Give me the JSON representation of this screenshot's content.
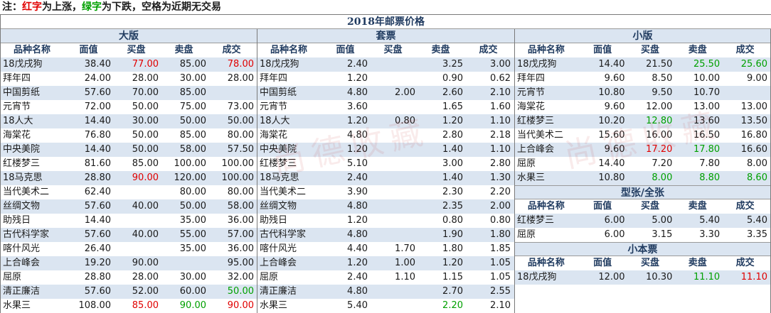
{
  "note": {
    "prefix": "注：",
    "red": "红字",
    "mid1": "为上涨，",
    "green": "绿字",
    "mid2": "为下跌，空格为近期无交易"
  },
  "title": "2018年邮票价格",
  "columns": [
    "品种名称",
    "面值",
    "买盘",
    "卖盘",
    "成交"
  ],
  "sections": {
    "daban": {
      "title": "大版",
      "rows": [
        {
          "name": "18戊戌狗",
          "face": "38.40",
          "buy": "77.00",
          "sell": "85.00",
          "deal": "78.00",
          "buy_color": "red",
          "sell_color": "",
          "deal_color": "red"
        },
        {
          "name": "拜年四",
          "face": "24.00",
          "buy": "28.00",
          "sell": "30.00",
          "deal": "28.00"
        },
        {
          "name": "中国剪纸",
          "face": "57.60",
          "buy": "70.00",
          "sell": "85.00",
          "deal": ""
        },
        {
          "name": "元宵节",
          "face": "72.00",
          "buy": "50.00",
          "sell": "75.00",
          "deal": "73.00"
        },
        {
          "name": "18人大",
          "face": "14.40",
          "buy": "30.00",
          "sell": "50.00",
          "deal": "50.00"
        },
        {
          "name": "海棠花",
          "face": "76.80",
          "buy": "50.00",
          "sell": "85.00",
          "deal": "80.00"
        },
        {
          "name": "中央美院",
          "face": "14.40",
          "buy": "50.00",
          "sell": "58.00",
          "deal": "57.50"
        },
        {
          "name": "红楼梦三",
          "face": "81.60",
          "buy": "85.00",
          "sell": "100.00",
          "deal": "100.00"
        },
        {
          "name": "18马克思",
          "face": "28.80",
          "buy": "90.00",
          "sell": "120.00",
          "deal": "100.00",
          "buy_color": "red"
        },
        {
          "name": "当代美术二",
          "face": "62.40",
          "buy": "",
          "sell": "80.00",
          "deal": "80.00"
        },
        {
          "name": "丝绸文物",
          "face": "57.60",
          "buy": "40.00",
          "sell": "50.00",
          "deal": "58.00"
        },
        {
          "name": "助残日",
          "face": "14.40",
          "buy": "",
          "sell": "35.00",
          "deal": "36.00"
        },
        {
          "name": "古代科学家",
          "face": "57.60",
          "buy": "40.00",
          "sell": "55.00",
          "deal": "57.00"
        },
        {
          "name": "喀什风光",
          "face": "26.40",
          "buy": "",
          "sell": "35.00",
          "deal": "36.00"
        },
        {
          "name": "上合峰会",
          "face": "19.20",
          "buy": "90.00",
          "sell": "",
          "deal": "95.00"
        },
        {
          "name": "屈原",
          "face": "28.80",
          "buy": "28.00",
          "sell": "30.00",
          "deal": "32.00"
        },
        {
          "name": "清正廉洁",
          "face": "57.60",
          "buy": "52.00",
          "sell": "60.00",
          "deal": "50.00",
          "deal_color": "green"
        },
        {
          "name": "水果三",
          "face": "108.00",
          "buy": "85.00",
          "sell": "90.00",
          "deal": "90.00",
          "buy_color": "red",
          "sell_color": "green",
          "deal_color": "red"
        }
      ]
    },
    "taopiao": {
      "title": "套票",
      "rows": [
        {
          "name": "18戊戌狗",
          "face": "2.40",
          "buy": "",
          "sell": "3.25",
          "deal": "3.00"
        },
        {
          "name": "拜年四",
          "face": "1.20",
          "buy": "",
          "sell": "0.90",
          "deal": "0.62"
        },
        {
          "name": "中国剪纸",
          "face": "4.80",
          "buy": "2.00",
          "sell": "2.60",
          "deal": "2.10"
        },
        {
          "name": "元宵节",
          "face": "3.60",
          "buy": "",
          "sell": "1.65",
          "deal": "1.60"
        },
        {
          "name": "18人大",
          "face": "1.20",
          "buy": "0.80",
          "sell": "1.20",
          "deal": "1.10"
        },
        {
          "name": "海棠花",
          "face": "4.80",
          "buy": "",
          "sell": "2.80",
          "deal": "2.18"
        },
        {
          "name": "中央美院",
          "face": "1.20",
          "buy": "",
          "sell": "1.40",
          "deal": "1.10"
        },
        {
          "name": "红楼梦三",
          "face": "5.10",
          "buy": "",
          "sell": "3.00",
          "deal": "2.80"
        },
        {
          "name": "18马克思",
          "face": "2.40",
          "buy": "",
          "sell": "1.40",
          "deal": "1.30"
        },
        {
          "name": "当代美术二",
          "face": "3.90",
          "buy": "",
          "sell": "2.30",
          "deal": "2.20"
        },
        {
          "name": "丝绸文物",
          "face": "4.80",
          "buy": "",
          "sell": "2.35",
          "deal": "2.00"
        },
        {
          "name": "助残日",
          "face": "1.20",
          "buy": "",
          "sell": "0.80",
          "deal": "0.80"
        },
        {
          "name": "古代科学家",
          "face": "4.80",
          "buy": "",
          "sell": "1.90",
          "deal": "1.80"
        },
        {
          "name": "喀什风光",
          "face": "4.40",
          "buy": "1.70",
          "sell": "1.80",
          "deal": "1.85"
        },
        {
          "name": "上合峰会",
          "face": "1.20",
          "buy": "1.00",
          "sell": "1.20",
          "deal": "1.05"
        },
        {
          "name": "屈原",
          "face": "2.40",
          "buy": "1.10",
          "sell": "1.15",
          "deal": "1.05"
        },
        {
          "name": "清正廉洁",
          "face": "4.80",
          "buy": "",
          "sell": "2.70",
          "deal": "2.55"
        },
        {
          "name": "水果三",
          "face": "5.40",
          "buy": "",
          "sell": "2.20",
          "deal": "2.10",
          "sell_color": "green"
        }
      ]
    },
    "xiaoban": {
      "title": "小版",
      "rows": [
        {
          "name": "18戊戌狗",
          "face": "14.40",
          "buy": "21.50",
          "sell": "25.50",
          "deal": "25.60",
          "sell_color": "green",
          "deal_color": "green"
        },
        {
          "name": "拜年四",
          "face": "9.60",
          "buy": "8.50",
          "sell": "10.00",
          "deal": "9.00"
        },
        {
          "name": "元宵节",
          "face": "10.80",
          "buy": "9.50",
          "sell": "10.70",
          "deal": ""
        },
        {
          "name": "海棠花",
          "face": "9.60",
          "buy": "12.00",
          "sell": "13.00",
          "deal": "13.00"
        },
        {
          "name": "红楼梦三",
          "face": "10.20",
          "buy": "12.80",
          "sell": "13.60",
          "deal": "13.50",
          "buy_color": "green"
        },
        {
          "name": "当代美术二",
          "face": "15.60",
          "buy": "16.00",
          "sell": "16.50",
          "deal": "16.80"
        },
        {
          "name": "上合峰会",
          "face": "9.60",
          "buy": "17.20",
          "sell": "17.80",
          "deal": "16.60",
          "buy_color": "red",
          "sell_color": "green"
        },
        {
          "name": "屈原",
          "face": "14.40",
          "buy": "7.20",
          "sell": "7.80",
          "deal": "8.00"
        },
        {
          "name": "水果三",
          "face": "10.80",
          "buy": "8.00",
          "sell": "8.80",
          "deal": "8.60",
          "buy_color": "green",
          "sell_color": "green",
          "deal_color": "green"
        }
      ]
    },
    "xingzhang": {
      "title": "型张/全张",
      "rows": [
        {
          "name": "红楼梦三",
          "face": "6.00",
          "buy": "5.00",
          "sell": "5.40",
          "deal": "5.40"
        },
        {
          "name": "屈原",
          "face": "6.00",
          "buy": "3.15",
          "sell": "3.30",
          "deal": "3.35"
        }
      ]
    },
    "xiaobenpiao": {
      "title": "小本票",
      "rows": [
        {
          "name": "18戊戌狗",
          "face": "12.00",
          "buy": "10.30",
          "sell": "11.10",
          "deal": "11.10",
          "sell_color": "green",
          "deal_color": "red"
        }
      ]
    }
  },
  "colors": {
    "up": "#e00000",
    "down": "#00a000",
    "header_text": "#1f3a5f",
    "row_shade": "#dbe5f1"
  }
}
